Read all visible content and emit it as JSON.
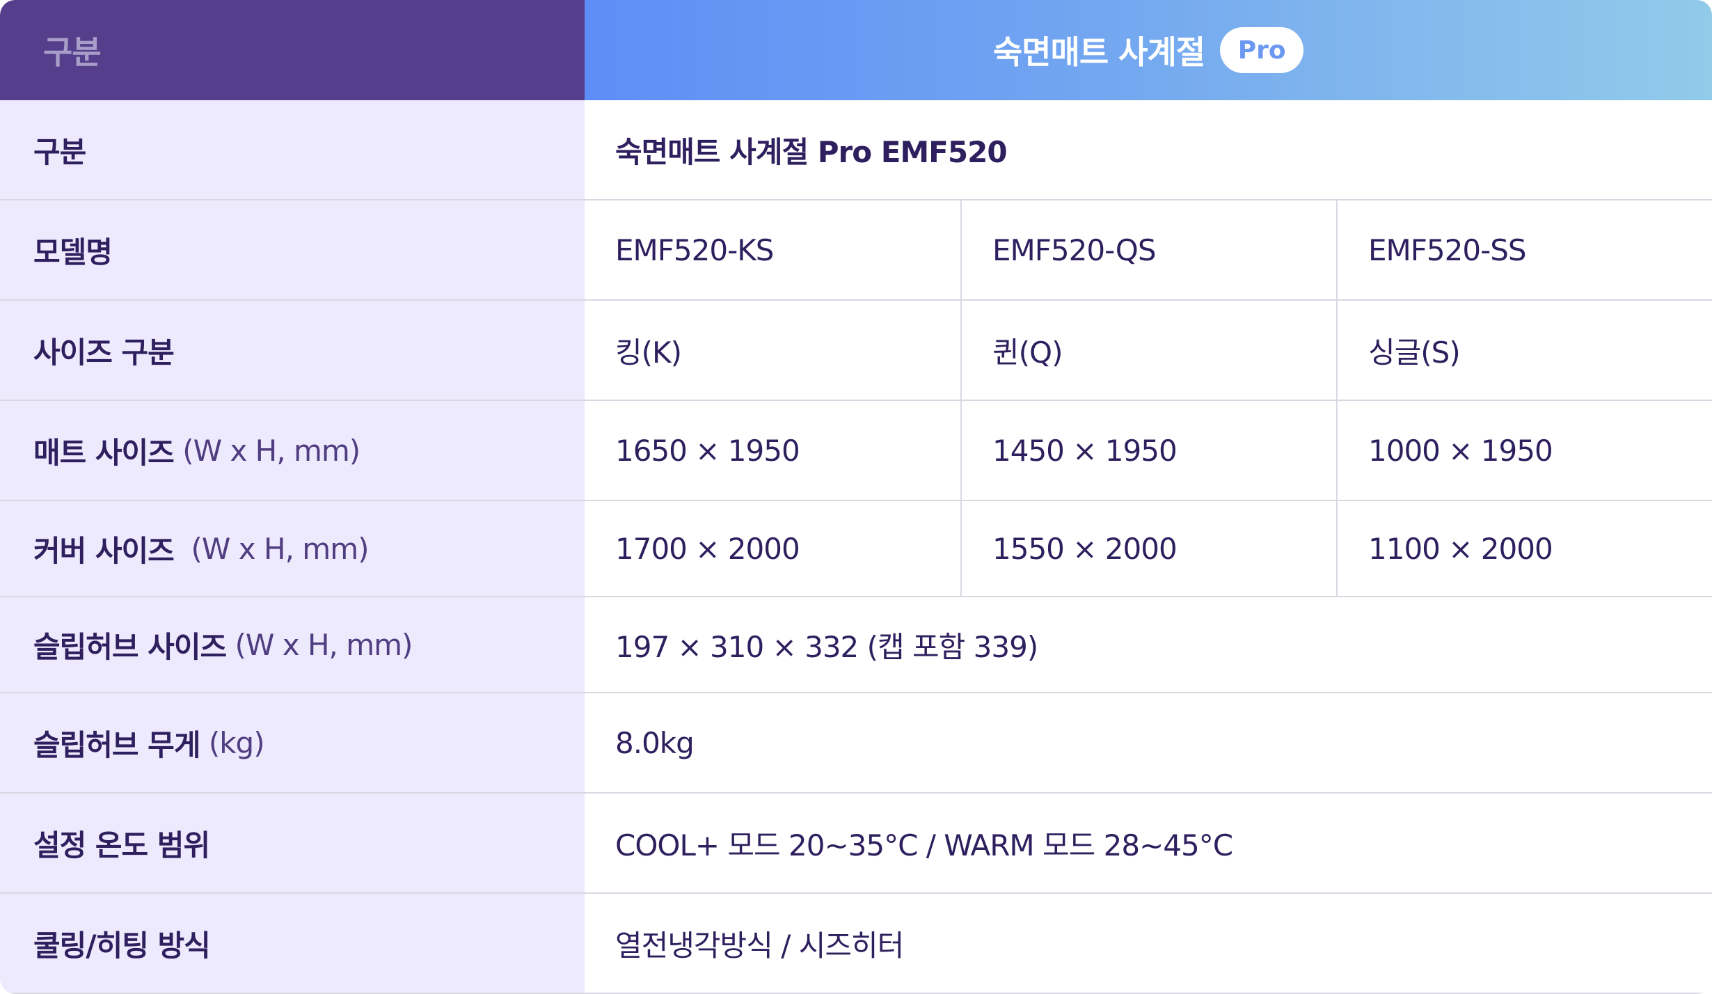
{
  "header": {
    "left_label": "구분",
    "product_title": "숙면매트 사계절",
    "badge": "Pro"
  },
  "rows": {
    "category": {
      "label": "구분",
      "value": "숙면매트 사계절 Pro EMF520"
    },
    "model": {
      "label": "모델명",
      "values": [
        "EMF520-KS",
        "EMF520-QS",
        "EMF520-SS"
      ]
    },
    "size_type": {
      "label": "사이즈 구분",
      "values": [
        "킹(K)",
        "퀸(Q)",
        "싱글(S)"
      ]
    },
    "mat_size": {
      "label": "매트 사이즈",
      "unit": "(W x H, mm)",
      "values": [
        "1650 × 1950",
        "1450 × 1950",
        "1000 × 1950"
      ]
    },
    "cover_size": {
      "label": "커버 사이즈",
      "unit": "(W x H, mm)",
      "values": [
        "1700 × 2000",
        "1550 × 2000",
        "1100 × 2000"
      ]
    },
    "hub_size": {
      "label": "슬립허브 사이즈",
      "unit": "(W x H, mm)",
      "value": "197 × 310 × 332 (캡 포함 339)"
    },
    "hub_weight": {
      "label": "슬립허브 무게",
      "unit": "(kg)",
      "value": "8.0kg"
    },
    "temp_range": {
      "label": "설정 온도 범위",
      "value": "COOL+ 모드 20~35°C / WARM 모드 28~45°C"
    },
    "method": {
      "label": "쿨링/히팅 방식",
      "value": "열전냉각방식 / 시즈히터"
    }
  }
}
